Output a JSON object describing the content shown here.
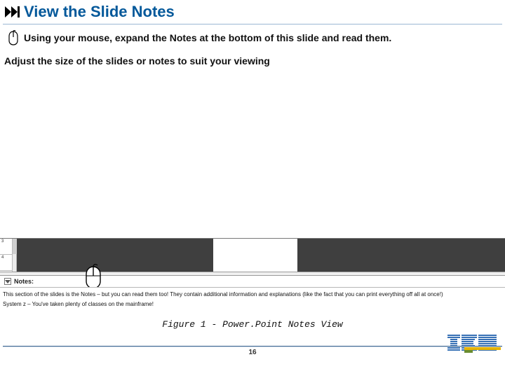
{
  "title": "View the Slide Notes",
  "instruction": "Using your mouse, expand the Notes at the bottom of this slide and read them.",
  "secondary": "Adjust the size of the slides or notes to suit your viewing",
  "screenshot": {
    "thumb_nums": [
      "3",
      "4"
    ],
    "notes_header": "Notes:",
    "notes_line1": "This section of the slides is the Notes – but you can read them too!  They contain additional information and explanations (like the fact that you can print everything off all at once!)",
    "notes_line2": "System z – You've taken plenty of classes on the mainframe!"
  },
  "caption": "Figure 1 - Power.Point Notes View",
  "page_number": "16",
  "logo_text": "IBM"
}
